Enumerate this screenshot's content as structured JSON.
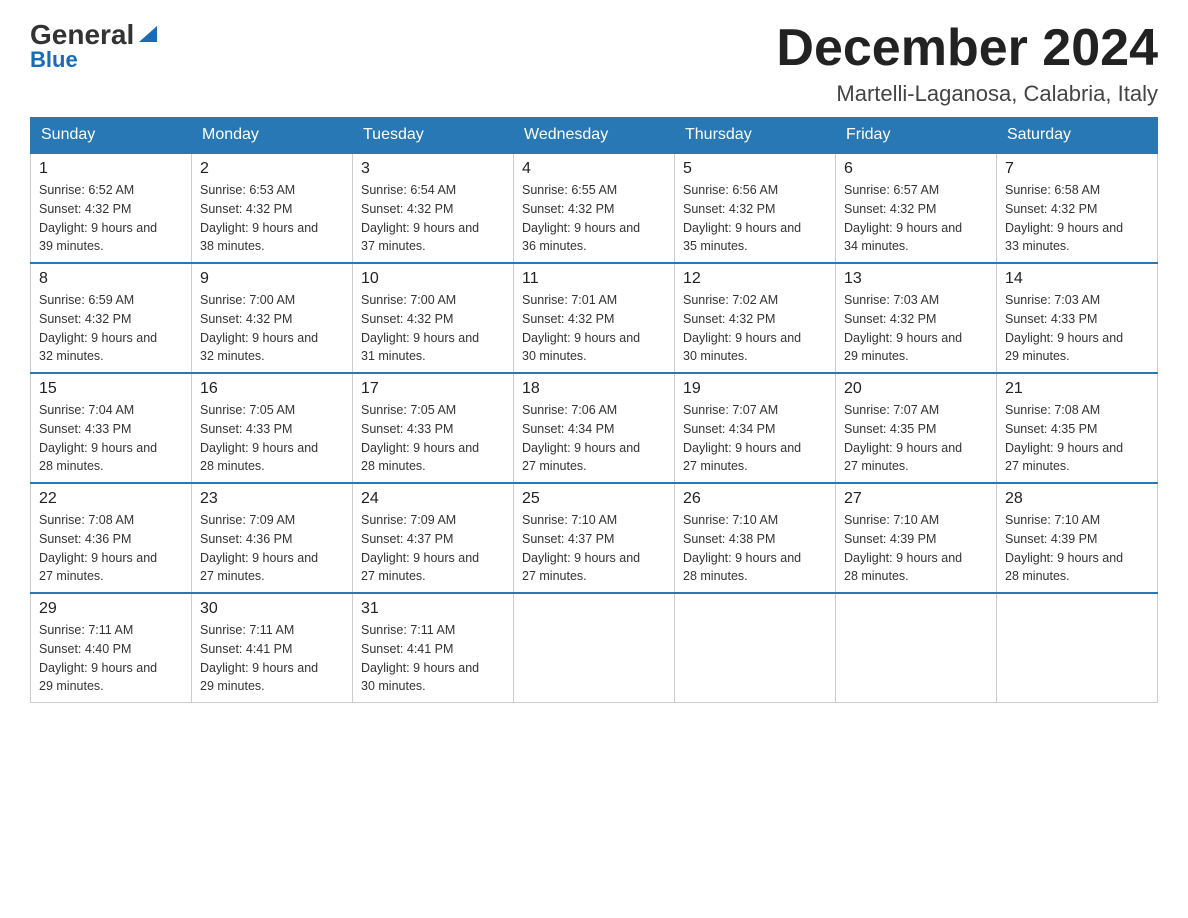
{
  "header": {
    "logo_name": "General",
    "logo_blue": "Blue",
    "month_title": "December 2024",
    "location": "Martelli-Laganosa, Calabria, Italy"
  },
  "days_of_week": [
    "Sunday",
    "Monday",
    "Tuesday",
    "Wednesday",
    "Thursday",
    "Friday",
    "Saturday"
  ],
  "weeks": [
    [
      {
        "date": "1",
        "sunrise": "6:52 AM",
        "sunset": "4:32 PM",
        "daylight": "9 hours and 39 minutes."
      },
      {
        "date": "2",
        "sunrise": "6:53 AM",
        "sunset": "4:32 PM",
        "daylight": "9 hours and 38 minutes."
      },
      {
        "date": "3",
        "sunrise": "6:54 AM",
        "sunset": "4:32 PM",
        "daylight": "9 hours and 37 minutes."
      },
      {
        "date": "4",
        "sunrise": "6:55 AM",
        "sunset": "4:32 PM",
        "daylight": "9 hours and 36 minutes."
      },
      {
        "date": "5",
        "sunrise": "6:56 AM",
        "sunset": "4:32 PM",
        "daylight": "9 hours and 35 minutes."
      },
      {
        "date": "6",
        "sunrise": "6:57 AM",
        "sunset": "4:32 PM",
        "daylight": "9 hours and 34 minutes."
      },
      {
        "date": "7",
        "sunrise": "6:58 AM",
        "sunset": "4:32 PM",
        "daylight": "9 hours and 33 minutes."
      }
    ],
    [
      {
        "date": "8",
        "sunrise": "6:59 AM",
        "sunset": "4:32 PM",
        "daylight": "9 hours and 32 minutes."
      },
      {
        "date": "9",
        "sunrise": "7:00 AM",
        "sunset": "4:32 PM",
        "daylight": "9 hours and 32 minutes."
      },
      {
        "date": "10",
        "sunrise": "7:00 AM",
        "sunset": "4:32 PM",
        "daylight": "9 hours and 31 minutes."
      },
      {
        "date": "11",
        "sunrise": "7:01 AM",
        "sunset": "4:32 PM",
        "daylight": "9 hours and 30 minutes."
      },
      {
        "date": "12",
        "sunrise": "7:02 AM",
        "sunset": "4:32 PM",
        "daylight": "9 hours and 30 minutes."
      },
      {
        "date": "13",
        "sunrise": "7:03 AM",
        "sunset": "4:32 PM",
        "daylight": "9 hours and 29 minutes."
      },
      {
        "date": "14",
        "sunrise": "7:03 AM",
        "sunset": "4:33 PM",
        "daylight": "9 hours and 29 minutes."
      }
    ],
    [
      {
        "date": "15",
        "sunrise": "7:04 AM",
        "sunset": "4:33 PM",
        "daylight": "9 hours and 28 minutes."
      },
      {
        "date": "16",
        "sunrise": "7:05 AM",
        "sunset": "4:33 PM",
        "daylight": "9 hours and 28 minutes."
      },
      {
        "date": "17",
        "sunrise": "7:05 AM",
        "sunset": "4:33 PM",
        "daylight": "9 hours and 28 minutes."
      },
      {
        "date": "18",
        "sunrise": "7:06 AM",
        "sunset": "4:34 PM",
        "daylight": "9 hours and 27 minutes."
      },
      {
        "date": "19",
        "sunrise": "7:07 AM",
        "sunset": "4:34 PM",
        "daylight": "9 hours and 27 minutes."
      },
      {
        "date": "20",
        "sunrise": "7:07 AM",
        "sunset": "4:35 PM",
        "daylight": "9 hours and 27 minutes."
      },
      {
        "date": "21",
        "sunrise": "7:08 AM",
        "sunset": "4:35 PM",
        "daylight": "9 hours and 27 minutes."
      }
    ],
    [
      {
        "date": "22",
        "sunrise": "7:08 AM",
        "sunset": "4:36 PM",
        "daylight": "9 hours and 27 minutes."
      },
      {
        "date": "23",
        "sunrise": "7:09 AM",
        "sunset": "4:36 PM",
        "daylight": "9 hours and 27 minutes."
      },
      {
        "date": "24",
        "sunrise": "7:09 AM",
        "sunset": "4:37 PM",
        "daylight": "9 hours and 27 minutes."
      },
      {
        "date": "25",
        "sunrise": "7:10 AM",
        "sunset": "4:37 PM",
        "daylight": "9 hours and 27 minutes."
      },
      {
        "date": "26",
        "sunrise": "7:10 AM",
        "sunset": "4:38 PM",
        "daylight": "9 hours and 28 minutes."
      },
      {
        "date": "27",
        "sunrise": "7:10 AM",
        "sunset": "4:39 PM",
        "daylight": "9 hours and 28 minutes."
      },
      {
        "date": "28",
        "sunrise": "7:10 AM",
        "sunset": "4:39 PM",
        "daylight": "9 hours and 28 minutes."
      }
    ],
    [
      {
        "date": "29",
        "sunrise": "7:11 AM",
        "sunset": "4:40 PM",
        "daylight": "9 hours and 29 minutes."
      },
      {
        "date": "30",
        "sunrise": "7:11 AM",
        "sunset": "4:41 PM",
        "daylight": "9 hours and 29 minutes."
      },
      {
        "date": "31",
        "sunrise": "7:11 AM",
        "sunset": "4:41 PM",
        "daylight": "9 hours and 30 minutes."
      },
      null,
      null,
      null,
      null
    ]
  ]
}
